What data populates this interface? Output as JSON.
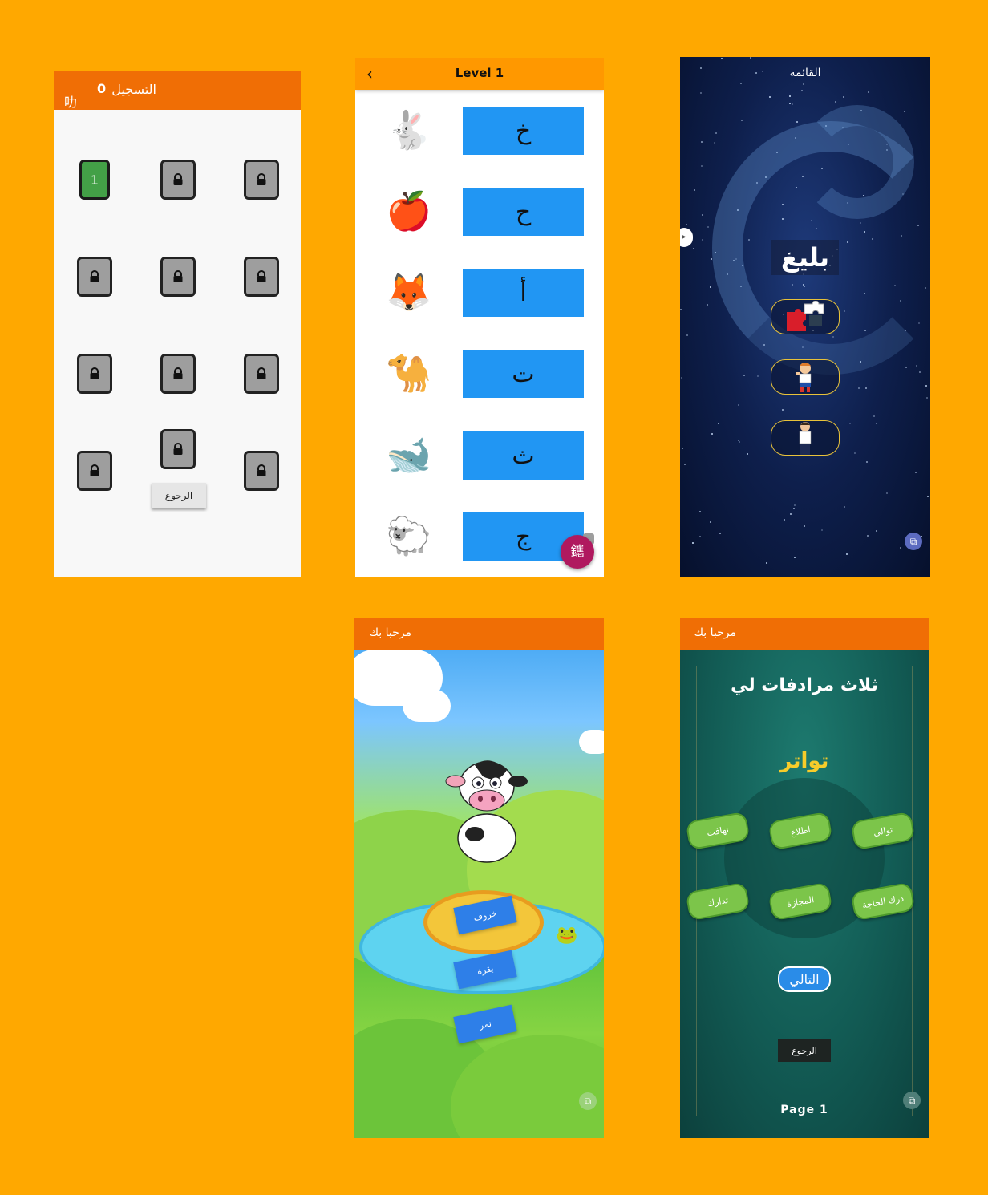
{
  "screen_levels": {
    "title": "التسجيل",
    "score": "0",
    "corner_glyph": "叻",
    "levels": [
      {
        "label": "1",
        "open": true
      },
      {
        "label": "",
        "open": false
      },
      {
        "label": "",
        "open": false
      },
      {
        "label": "",
        "open": false
      },
      {
        "label": "",
        "open": false
      },
      {
        "label": "",
        "open": false
      },
      {
        "label": "",
        "open": false
      },
      {
        "label": "",
        "open": false
      },
      {
        "label": "",
        "open": false
      },
      {
        "label": "",
        "open": false
      },
      {
        "label": "",
        "open": false
      },
      {
        "label": "",
        "open": false
      }
    ],
    "back_label": "الرجوع"
  },
  "screen_letters": {
    "title": "Level 1",
    "back_icon": "chevron-left-icon",
    "rows": [
      {
        "emoji": "🐇",
        "letter": "خ"
      },
      {
        "emoji": "🍎",
        "letter": "ح"
      },
      {
        "emoji": "🦊",
        "letter": "أ"
      },
      {
        "emoji": "🐪",
        "letter": "ت"
      },
      {
        "emoji": "🐋",
        "letter": "ث"
      },
      {
        "emoji": "🐑",
        "letter": "ج"
      }
    ],
    "fab_glyph": "鑴"
  },
  "screen_menu": {
    "title": "القائمة",
    "logo": "بليغ",
    "menu_icons": [
      "puzzle-icon",
      "boy-icon",
      "man-icon"
    ]
  },
  "screen_farm": {
    "title": "مرحبا بك",
    "words": [
      "خروف",
      "بقرة",
      "نمر"
    ]
  },
  "screen_quiz": {
    "title": "مرحبا بك",
    "heading": "ثلاث مرادفات لي",
    "word": "تواتر",
    "options": [
      "تهافت",
      "اطلاع",
      "توالي",
      "تدارك",
      "المجازة",
      "درك الحاجة"
    ],
    "next_label": "التالي",
    "back_label": "الرجوع",
    "page_label": "Page 1"
  },
  "colors": {
    "background": "#FFA800",
    "appbar": "#F06E05",
    "letter_button": "#2196F3",
    "level_open": "#43A047",
    "level_locked": "#9E9E9E",
    "option_green": "#7CC54A",
    "quiz_word": "#F7CC2A"
  }
}
